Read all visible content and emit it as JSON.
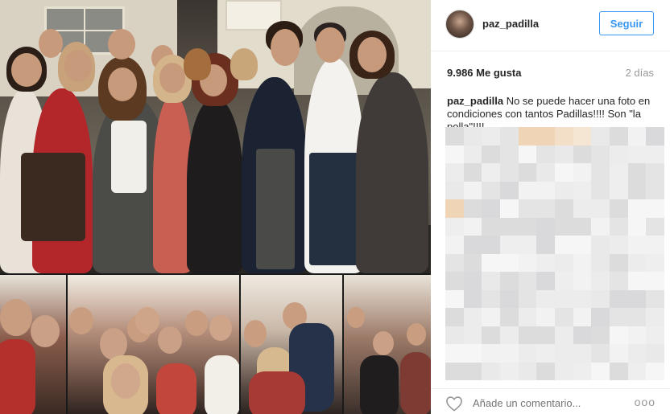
{
  "post": {
    "username": "paz_padilla",
    "follow_label": "Seguir",
    "likes": "9.986 Me gusta",
    "time_ago": "2 días",
    "caption_user": "paz_padilla",
    "caption_text": "No se puede hacer una foto en condiciones con tantos Padillas!!!! Son \"la polla\"!!!!",
    "comment_placeholder": "Añade un comentario...",
    "more_label": "ooo"
  },
  "colors": {
    "accent": "#3897f0",
    "muted": "#999999",
    "text": "#262626"
  },
  "icons": {
    "like": "heart-outline-icon",
    "more": "more-options-icon"
  }
}
